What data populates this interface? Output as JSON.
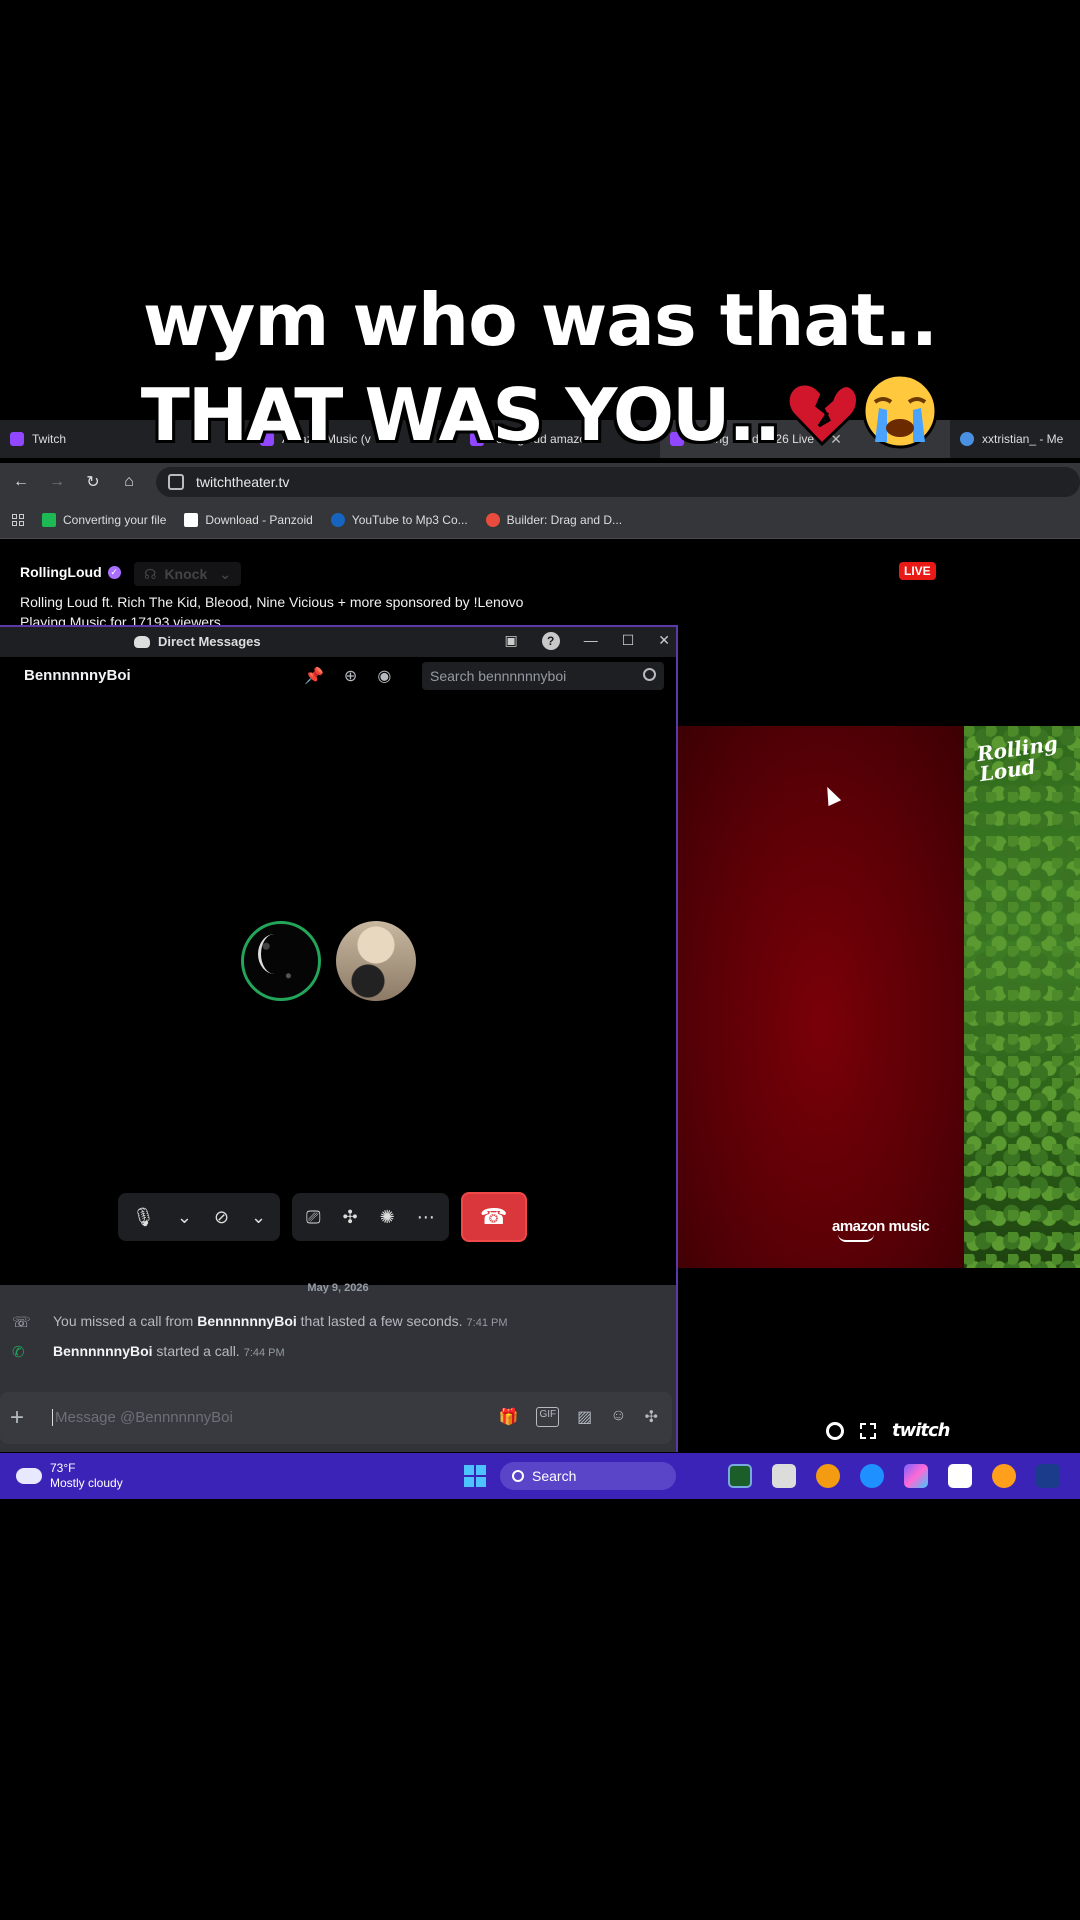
{
  "caption": {
    "line1": "wym who was that..",
    "line2": "THAT WAS YOU..",
    "emojis": [
      "broken-heart-icon",
      "crying-face-icon"
    ]
  },
  "browser": {
    "tabs": [
      {
        "label": "Twitch",
        "favicon_color": "#9146ff"
      },
      {
        "label": "AmazonMusic (v",
        "favicon_color": "#9146ff"
      },
      {
        "label": "rollingloud amazon",
        "favicon_color": "#9146ff"
      },
      {
        "label": "Rolling Loud 2026 Live",
        "favicon_color": "#9146ff"
      },
      {
        "label": "xxtristian_ - Me",
        "favicon_color": "#4a90e2"
      }
    ],
    "address": "twitchtheater.tv",
    "bookmarks": [
      {
        "label": "Converting your file",
        "color": "#1db954"
      },
      {
        "label": "Download - Panzoid",
        "color": "#ffffff"
      },
      {
        "label": "YouTube to Mp3 Co...",
        "color": "#1565c0"
      },
      {
        "label": "Builder: Drag and D...",
        "color": "#e94b3c"
      }
    ]
  },
  "twitch": {
    "channel": "RollingLoud",
    "knock": "Knock",
    "title": "Rolling Loud ft. Rich The Kid, Bleood, Nine Vicious + more sponsored by !Lenovo",
    "subtitle": "Playing Music for 17193 viewers",
    "live": "LIVE",
    "video_logo": "Rolling Loud",
    "sponsor": "amazon music",
    "brand": "twitch"
  },
  "discord": {
    "window_title": "Direct Messages",
    "dm_user": "BennnnnnyBoi",
    "search_placeholder": "Search bennnnnnyboi",
    "date": "May 9, 2026",
    "messages": [
      {
        "pre": "You missed a call from ",
        "user": "BennnnnnyBoi",
        "post": " that lasted a few seconds.",
        "time": "7:41 PM"
      },
      {
        "pre": "",
        "user": "BennnnnnyBoi",
        "post": " started a call.",
        "time": "7:44 PM"
      }
    ],
    "message_placeholder": "Message @BennnnnnyBoi"
  },
  "taskbar": {
    "temp": "73°F",
    "condition": "Mostly cloudy",
    "search": "Search"
  }
}
